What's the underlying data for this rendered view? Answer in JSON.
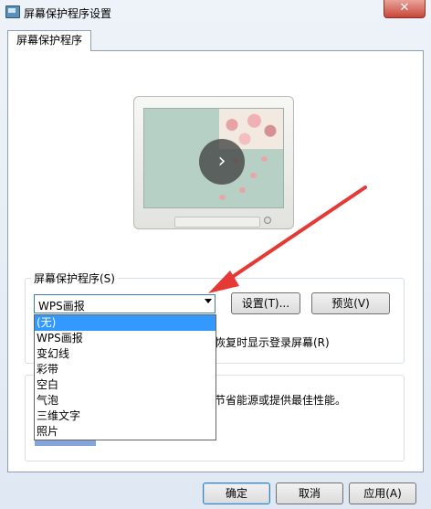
{
  "window": {
    "title": "屏幕保护程序设置",
    "close_label": "✕"
  },
  "tab": {
    "label": "屏幕保护程序"
  },
  "group": {
    "label": "屏幕保护程序(S)"
  },
  "combo": {
    "selected": "WPS画报"
  },
  "buttons": {
    "settings": "设置(T)...",
    "preview": "预览(V)",
    "ok": "确定",
    "cancel": "取消",
    "apply": "应用(A)"
  },
  "dropdown": {
    "options": [
      "(无)",
      "WPS画报",
      "变幻线",
      "彩带",
      "空白",
      "气泡",
      "三维文字",
      "照片"
    ],
    "highlighted_index": 0
  },
  "partial_text": {
    "resume": "恢复时显示登录屏幕(R)",
    "power": "节省能源或提供最佳性能。"
  },
  "colors": {
    "accent": "#3399ff",
    "arrow": "#e53935",
    "close": "#c8463a"
  }
}
